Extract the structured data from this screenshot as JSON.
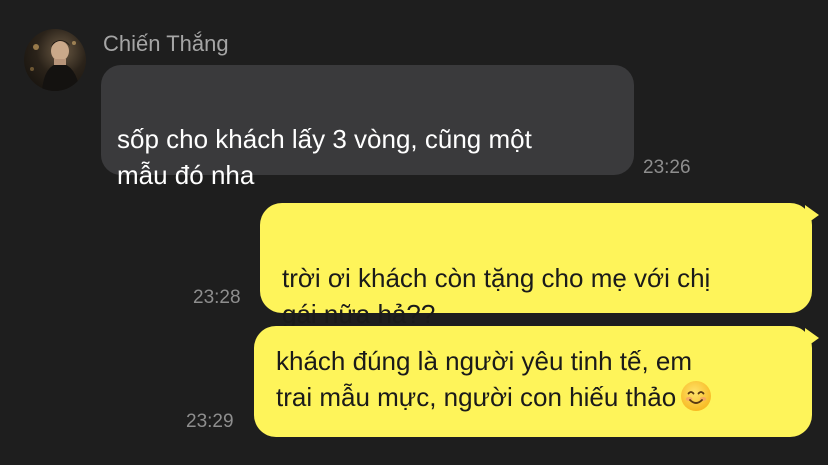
{
  "conversation": {
    "sender_name": "Chiến Thắng",
    "messages": [
      {
        "direction": "incoming",
        "text": "sốp cho khách lấy 3 vòng, cũng một\nmẫu đó nha",
        "time": "23:26"
      },
      {
        "direction": "outgoing",
        "text": "trời ơi khách còn tặng cho mẹ với chị\ngái nữa hả??",
        "time": "23:28"
      },
      {
        "direction": "outgoing",
        "text": "khách đúng là người yêu tinh tế, em\ntrai mẫu mực, người con hiếu thảo",
        "emoji": "smiling-face-emoji",
        "time": "23:29"
      }
    ]
  },
  "colors": {
    "background": "#1e1e1e",
    "incoming_bubble": "#3a3a3c",
    "outgoing_bubble": "#fef45a",
    "sender_name": "#a5a5a5",
    "timestamp": "#8e8e8e"
  }
}
